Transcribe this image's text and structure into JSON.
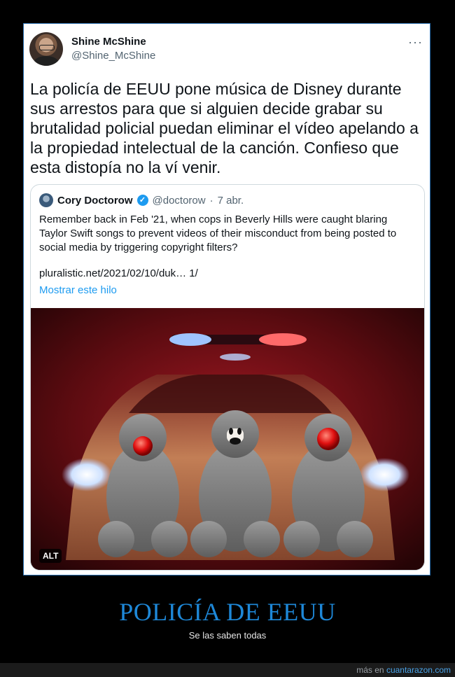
{
  "tweet": {
    "display_name": "Shine McShine",
    "handle": "@Shine_McShine",
    "more_icon": "···",
    "text": "La policía de EEUU pone música de Disney durante sus arrestos para que si alguien decide grabar su brutalidad policial puedan eliminar el vídeo apelando a la propiedad intelectual de la canción. Confieso que esta distopía no la ví venir."
  },
  "quoted": {
    "display_name": "Cory Doctorow",
    "verified_icon": "✓",
    "handle": "@doctorow",
    "separator": "·",
    "date": "7 abr.",
    "text": "Remember back in Feb '21, when cops in Beverly Hills were caught blaring Taylor Swift songs to prevent videos of their misconduct from being posted to social media by triggering copyright filters?",
    "link": "pluralistic.net/2021/02/10/duk… 1/",
    "show_thread": "Mostrar este hilo",
    "alt_badge": "ALT"
  },
  "caption": {
    "title": "POLICÍA DE EEUU",
    "subtitle": "Se las saben todas"
  },
  "footer": {
    "prefix": "más en",
    "site": "cuantarazon.com"
  },
  "colors": {
    "frame_border": "#2a6fb0",
    "caption_title": "#1e88d8",
    "link_blue": "#1d9bf0"
  }
}
